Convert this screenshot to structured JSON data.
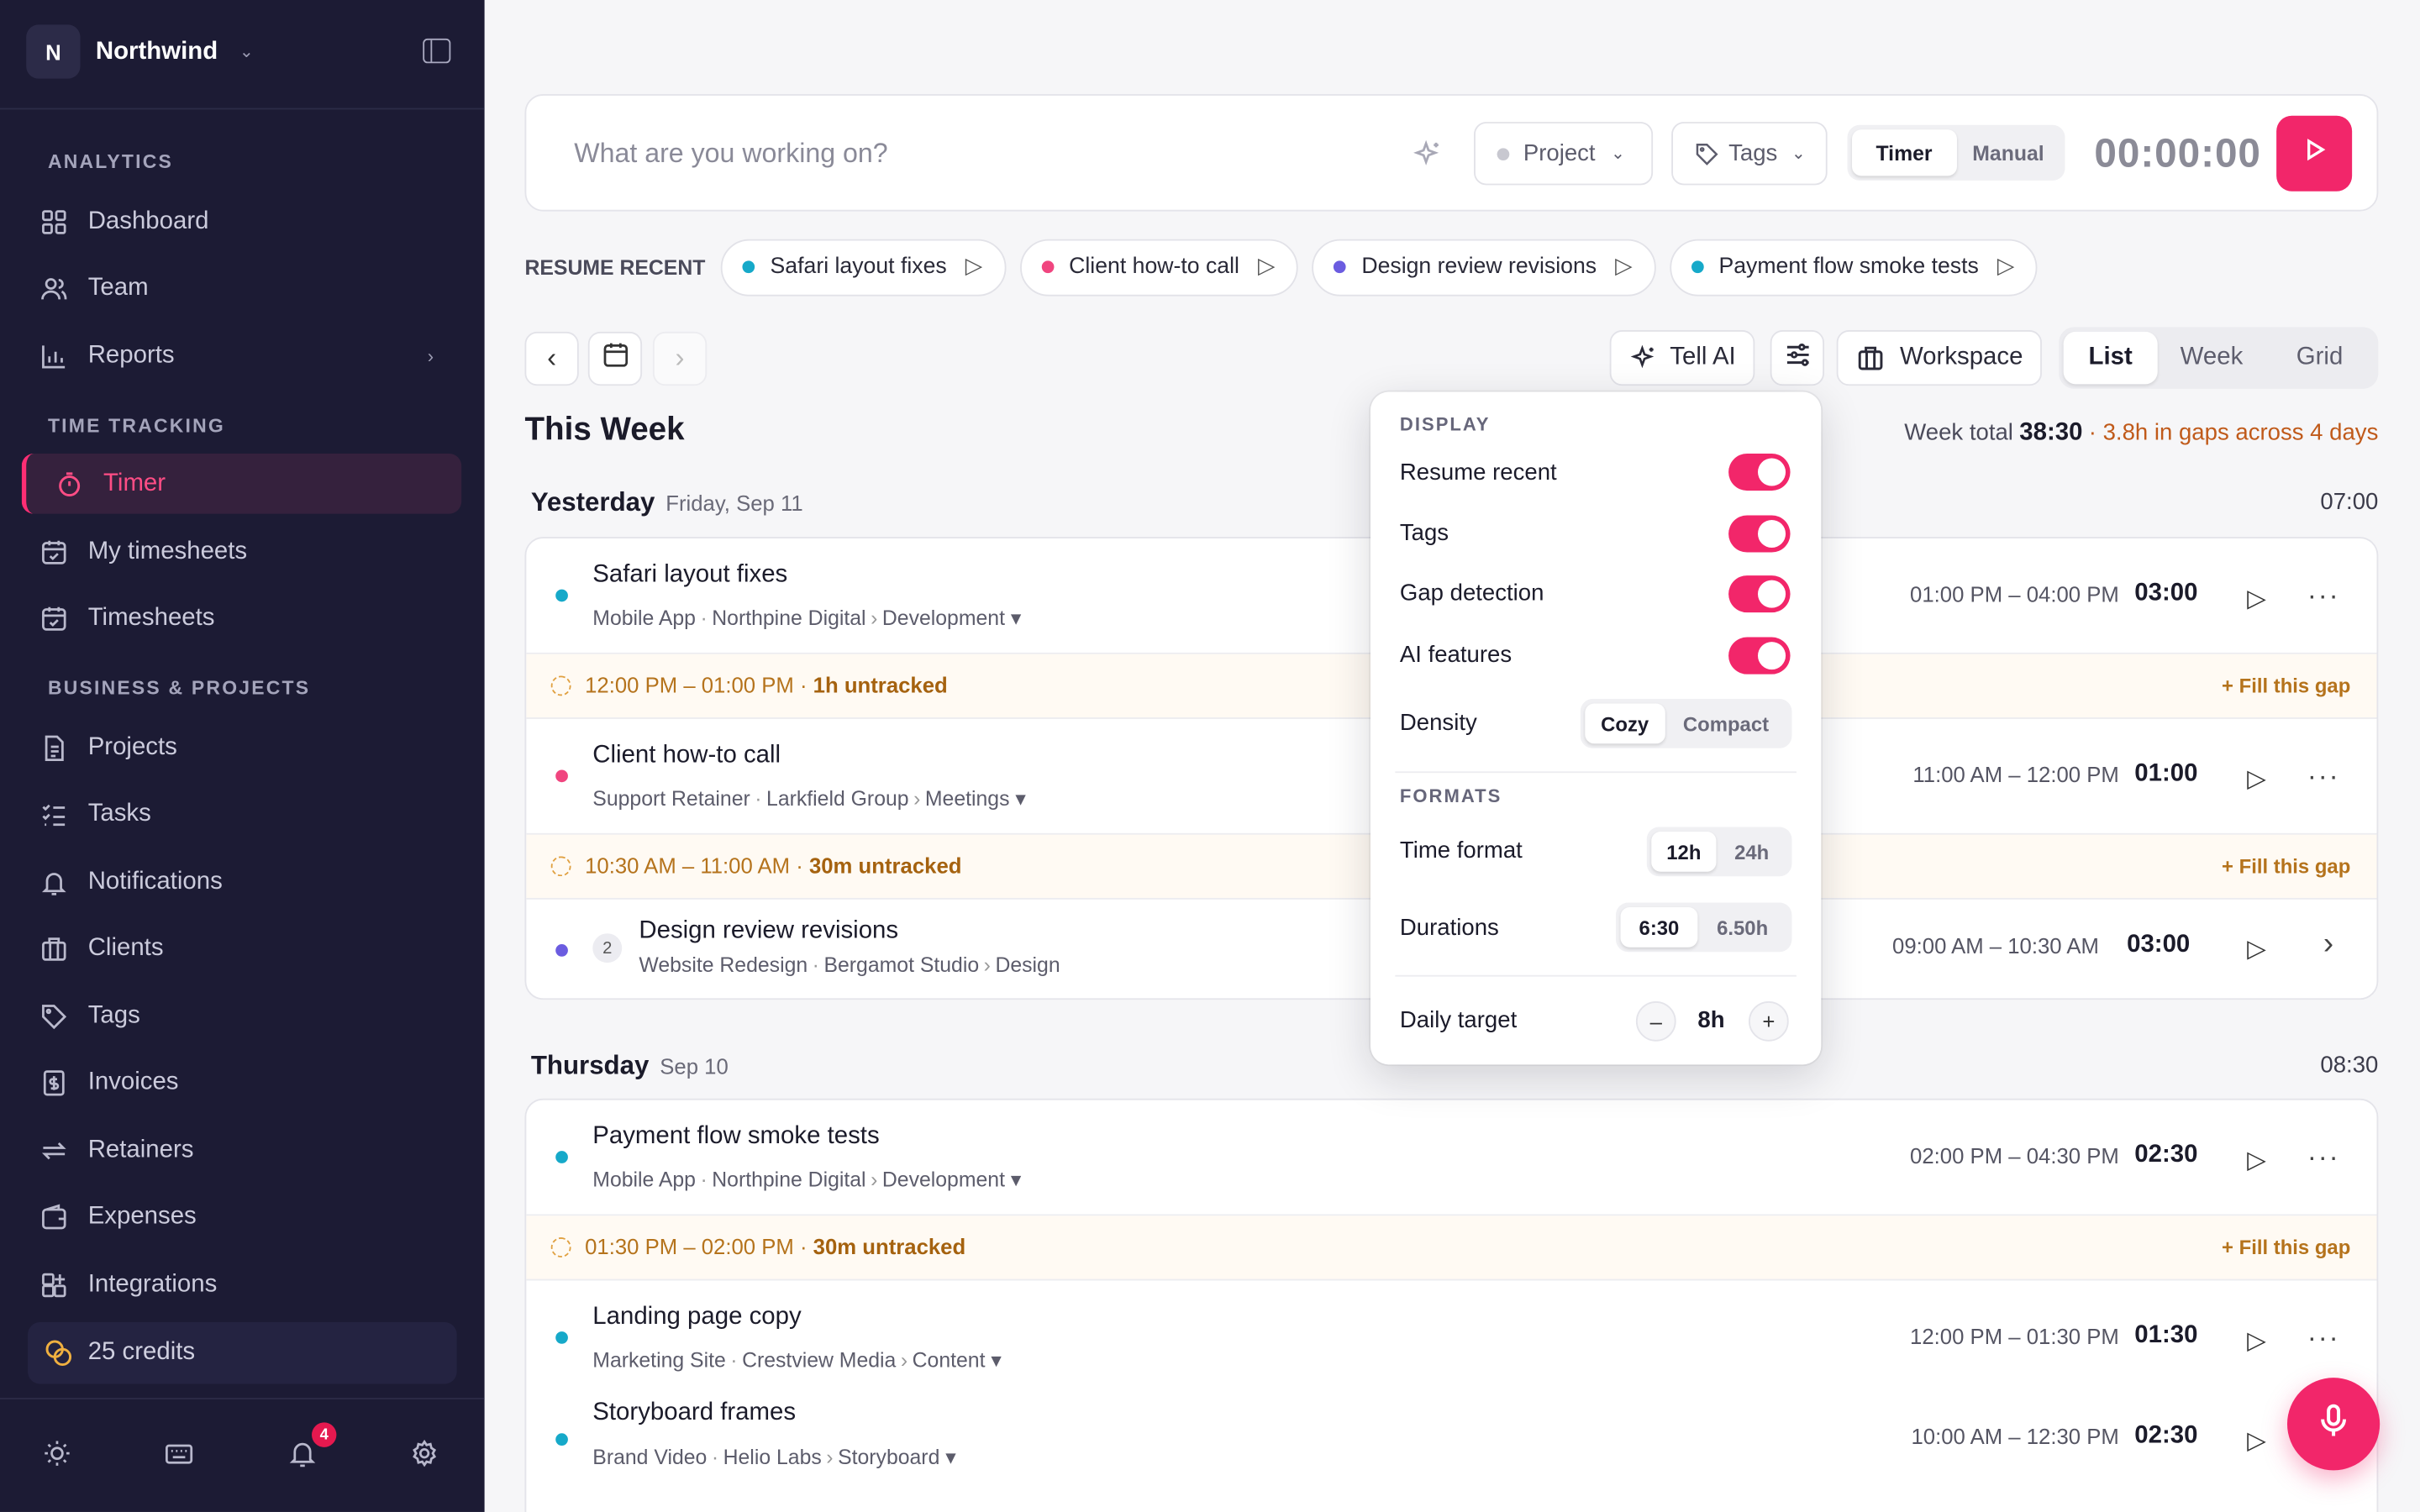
{
  "workspace": {
    "initial": "N",
    "name": "Northwind"
  },
  "sidebar": {
    "sections": {
      "analytics": "ANALYTICS",
      "time": "TIME TRACKING",
      "business": "BUSINESS & PROJECTS"
    },
    "items": [
      "Dashboard",
      "Team",
      "Reports",
      "Timer",
      "My timesheets",
      "Timesheets",
      "Projects",
      "Tasks",
      "Notifications",
      "Clients",
      "Tags",
      "Invoices",
      "Retainers",
      "Expenses",
      "Integrations"
    ],
    "credits": "25 credits",
    "notif_count": "4"
  },
  "timer": {
    "placeholder": "What are you working on?",
    "project": "Project",
    "tags": "Tags",
    "mode_timer": "Timer",
    "mode_manual": "Manual",
    "clock": "00:00:00"
  },
  "resume": {
    "label": "RESUME RECENT",
    "chips": [
      "Safari layout fixes",
      "Client how-to call",
      "Design review revisions",
      "Payment flow smoke tests"
    ]
  },
  "toolbar": {
    "tell_ai": "Tell AI",
    "workspace": "Workspace",
    "views": [
      "List",
      "Week",
      "Grid"
    ]
  },
  "week": {
    "title": "This Week",
    "total_label": "Week total",
    "total": "38:30",
    "gaps": "· 3.8h in gaps across 4 days"
  },
  "days": [
    {
      "name": "Yesterday",
      "date": "Friday, Sep 11",
      "total": "07:00"
    },
    {
      "name": "Thursday",
      "date": "Sep 10",
      "total": "08:30"
    }
  ],
  "entries": [
    {
      "title": "Safari layout fixes",
      "project": "Mobile App",
      "client": "Northpine Digital",
      "task": "Development ▾",
      "range": "01:00 PM – 04:00 PM",
      "dur": "03:00"
    },
    {
      "title": "Client how-to call",
      "project": "Support Retainer",
      "client": "Larkfield Group",
      "task": "Meetings ▾",
      "range": "11:00 AM – 12:00 PM",
      "dur": "01:00"
    },
    {
      "title": "Design review revisions",
      "project": "Website Redesign",
      "client": "Bergamot Studio",
      "task": "Design",
      "range": "09:00 AM – 10:30 AM",
      "dur": "03:00",
      "count": "2"
    },
    {
      "title": "Payment flow smoke tests",
      "project": "Mobile App",
      "client": "Northpine Digital",
      "task": "Development ▾",
      "range": "02:00 PM – 04:30 PM",
      "dur": "02:30"
    },
    {
      "title": "Landing page copy",
      "project": "Marketing Site",
      "client": "Crestview Media",
      "task": "Content ▾",
      "range": "12:00 PM – 01:30 PM",
      "dur": "01:30"
    },
    {
      "title": "Storyboard frames",
      "project": "Brand Video",
      "client": "Helio Labs",
      "task": "Storyboard ▾",
      "range": "10:00 AM – 12:30 PM",
      "dur": "02:30"
    }
  ],
  "gaps": [
    {
      "range": "12:00 PM – 01:00 PM ·",
      "amt": "1h untracked"
    },
    {
      "range": "10:30 AM – 11:00 AM ·",
      "amt": "30m untracked"
    },
    {
      "range": "01:30 PM – 02:00 PM ·",
      "amt": "30m untracked"
    }
  ],
  "fill_gap": "+ Fill this gap",
  "popover": {
    "display": "DISPLAY",
    "resume_recent": "Resume recent",
    "tags": "Tags",
    "gap_detection": "Gap detection",
    "ai_features": "AI features",
    "density": "Density",
    "cozy": "Cozy",
    "compact": "Compact",
    "formats": "FORMATS",
    "time_format": "Time format",
    "h12": "12h",
    "h24": "24h",
    "durations": "Durations",
    "d1": "6:30",
    "d2": "6.50h",
    "daily_target": "Daily target",
    "minus": "–",
    "target": "8h",
    "plus": "+"
  },
  "colors": {
    "accent": "#f2266a",
    "sidebar": "#1c1b34",
    "teal": "#16a9c9",
    "pink": "#f0457f",
    "purple": "#6b5ce0"
  }
}
